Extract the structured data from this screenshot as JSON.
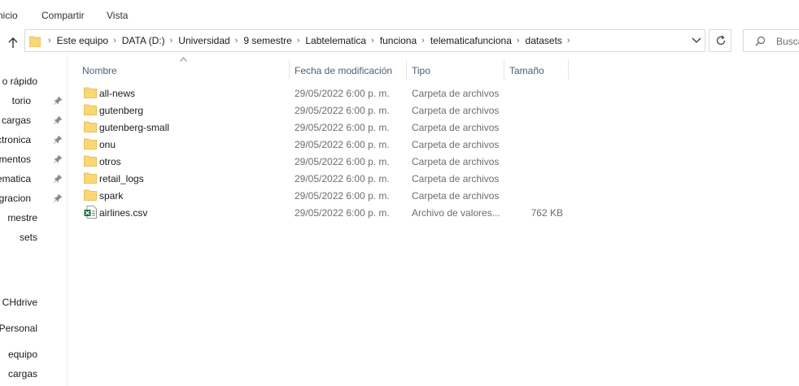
{
  "ribbon": {
    "tabs": [
      "nicio",
      "Compartir",
      "Vista"
    ]
  },
  "address": {
    "crumbs": [
      "Este equipo",
      "DATA (D:)",
      "Universidad",
      "9 semestre",
      "Labtelematica",
      "funciona",
      "telematicafunciona",
      "datasets"
    ]
  },
  "search": {
    "placeholder": "Busca"
  },
  "nav": {
    "items": [
      {
        "label": "o rápido",
        "pinned": false
      },
      {
        "label": "torio",
        "pinned": true
      },
      {
        "label": "cargas",
        "pinned": true
      },
      {
        "label": "ctronica",
        "pinned": true
      },
      {
        "label": "umentos",
        "pinned": true
      },
      {
        "label": "elematica",
        "pinned": true
      },
      {
        "label": "gracion",
        "pinned": true
      },
      {
        "label": "mestre",
        "pinned": false
      },
      {
        "label": "sets",
        "pinned": false
      },
      {
        "label": "CHdrive",
        "pinned": false
      },
      {
        "label": "rive - Personal",
        "pinned": false
      },
      {
        "label": "equipo",
        "pinned": false
      },
      {
        "label": "cargas",
        "pinned": false
      }
    ]
  },
  "columns": {
    "name": "Nombre",
    "date": "Fecha de modificación",
    "type": "Tipo",
    "size": "Tamaño"
  },
  "files": [
    {
      "name": "all-news",
      "date": "29/05/2022 6:00 p. m.",
      "type": "Carpeta de archivos",
      "size": "",
      "icon": "folder-icon"
    },
    {
      "name": "gutenberg",
      "date": "29/05/2022 6:00 p. m.",
      "type": "Carpeta de archivos",
      "size": "",
      "icon": "folder-icon"
    },
    {
      "name": "gutenberg-small",
      "date": "29/05/2022 6:00 p. m.",
      "type": "Carpeta de archivos",
      "size": "",
      "icon": "folder-icon"
    },
    {
      "name": "onu",
      "date": "29/05/2022 6:00 p. m.",
      "type": "Carpeta de archivos",
      "size": "",
      "icon": "folder-icon"
    },
    {
      "name": "otros",
      "date": "29/05/2022 6:00 p. m.",
      "type": "Carpeta de archivos",
      "size": "",
      "icon": "folder-icon"
    },
    {
      "name": "retail_logs",
      "date": "29/05/2022 6:00 p. m.",
      "type": "Carpeta de archivos",
      "size": "",
      "icon": "folder-icon"
    },
    {
      "name": "spark",
      "date": "29/05/2022 6:00 p. m.",
      "type": "Carpeta de archivos",
      "size": "",
      "icon": "folder-icon"
    },
    {
      "name": "airlines.csv",
      "date": "29/05/2022 6:00 p. m.",
      "type": "Archivo de valores...",
      "size": "762 KB",
      "icon": "excel-csv-icon"
    }
  ],
  "colors": {
    "folder": "#f8d775",
    "folder_dark": "#e0b545",
    "header_text": "#4c607a",
    "excel_green": "#1d6f42"
  }
}
